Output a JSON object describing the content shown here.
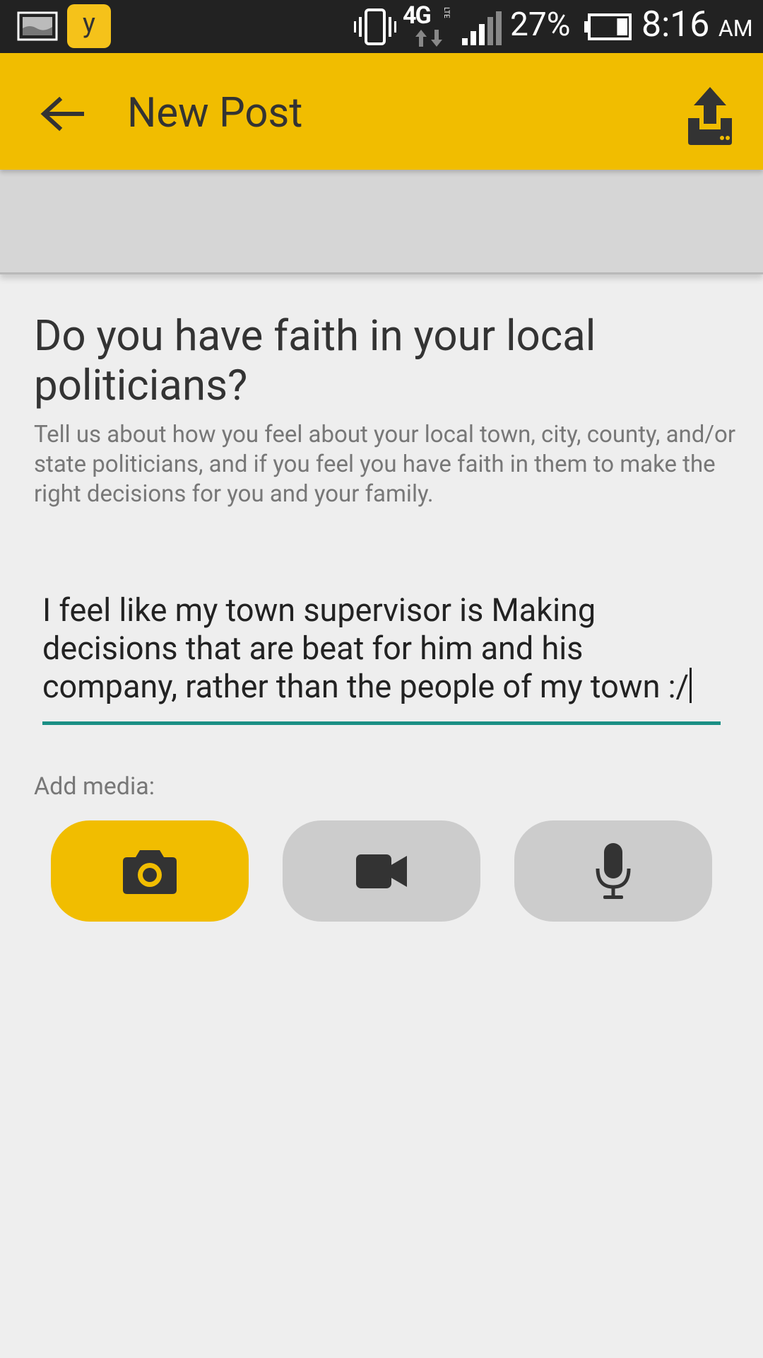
{
  "status_bar": {
    "app_letter": "y",
    "network": "4G",
    "network_sub": "LTE",
    "battery_percent": "27%",
    "battery_level": 0.27,
    "time": "8:16",
    "ampm": "AM"
  },
  "app_bar": {
    "title": "New Post",
    "background_color": "#f1bd00"
  },
  "prompt": {
    "title": "Do you have faith in your local politicians?",
    "description": "Tell us about how you feel about your local town, city, county, and/or state politicians, and if you feel you have faith in them to make the right decisions for you and your family."
  },
  "post_input": {
    "value": "I feel like my town supervisor is Making decisions that are beat for him and his company, rather than the people of my town :/",
    "underline_color": "#1a8f84"
  },
  "media": {
    "label": "Add media:",
    "buttons": [
      {
        "icon": "camera-icon",
        "active": true
      },
      {
        "icon": "video-camera-icon",
        "active": false
      },
      {
        "icon": "microphone-icon",
        "active": false
      }
    ]
  }
}
